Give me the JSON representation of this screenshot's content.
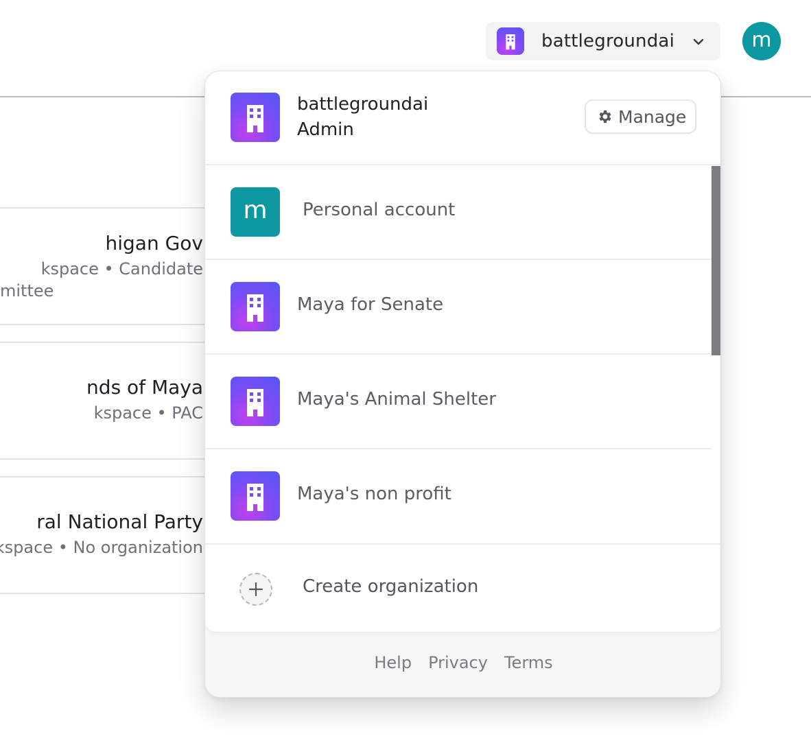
{
  "header": {
    "org_switcher": {
      "name": "battlegroundai",
      "icon": "building-icon"
    },
    "avatar_letter": "m",
    "avatar_color": "#0d97a0"
  },
  "workspaces": [
    {
      "title": "higan Gov",
      "subtitle_1": "kspace • Candidate",
      "subtitle_2": "mittee"
    },
    {
      "title": "nds of Maya",
      "subtitle_1": "kspace • PAC"
    },
    {
      "title": "ral National Party",
      "subtitle_1": "kspace • No organization"
    }
  ],
  "popover": {
    "active_org": {
      "name": "battlegroundai",
      "role": "Admin",
      "manage_label": "Manage"
    },
    "accounts": [
      {
        "label": "Personal account",
        "badge_letter": "m",
        "type": "personal"
      },
      {
        "label": "Maya for Senate",
        "type": "organization"
      },
      {
        "label": "Maya's Animal Shelter",
        "type": "organization"
      },
      {
        "label": "Maya's non profit",
        "type": "organization"
      }
    ],
    "create_label": "Create organization",
    "footer": {
      "help": "Help",
      "privacy": "Privacy",
      "terms": "Terms"
    }
  },
  "colors": {
    "accent_purple": "#6d4ef2",
    "teal": "#0d97a0",
    "text_primary": "#1f2024",
    "text_muted": "#5c5d63"
  }
}
